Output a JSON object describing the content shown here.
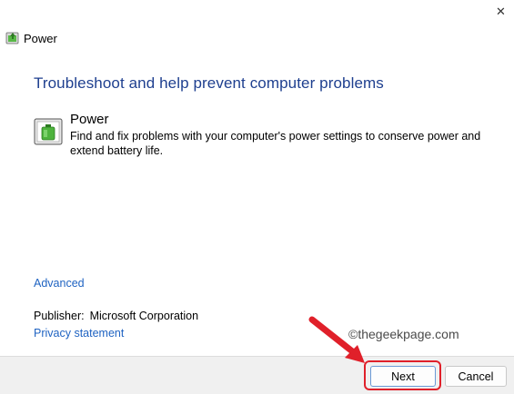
{
  "window": {
    "title": "Power",
    "close_glyph": "✕"
  },
  "main": {
    "heading": "Troubleshoot and help prevent computer problems",
    "tool": {
      "name": "Power",
      "description": "Find and fix problems with your computer's power settings to conserve power and extend battery life.",
      "icon": "power-battery-icon"
    },
    "advanced_link": "Advanced",
    "publisher_label": "Publisher:",
    "publisher_value": "Microsoft Corporation",
    "privacy_link": "Privacy statement",
    "watermark": "©thegeekpage.com"
  },
  "footer": {
    "next_label": "Next",
    "cancel_label": "Cancel"
  },
  "colors": {
    "heading": "#1e3f8f",
    "link": "#1f63c2",
    "annotation": "#e0202a"
  }
}
